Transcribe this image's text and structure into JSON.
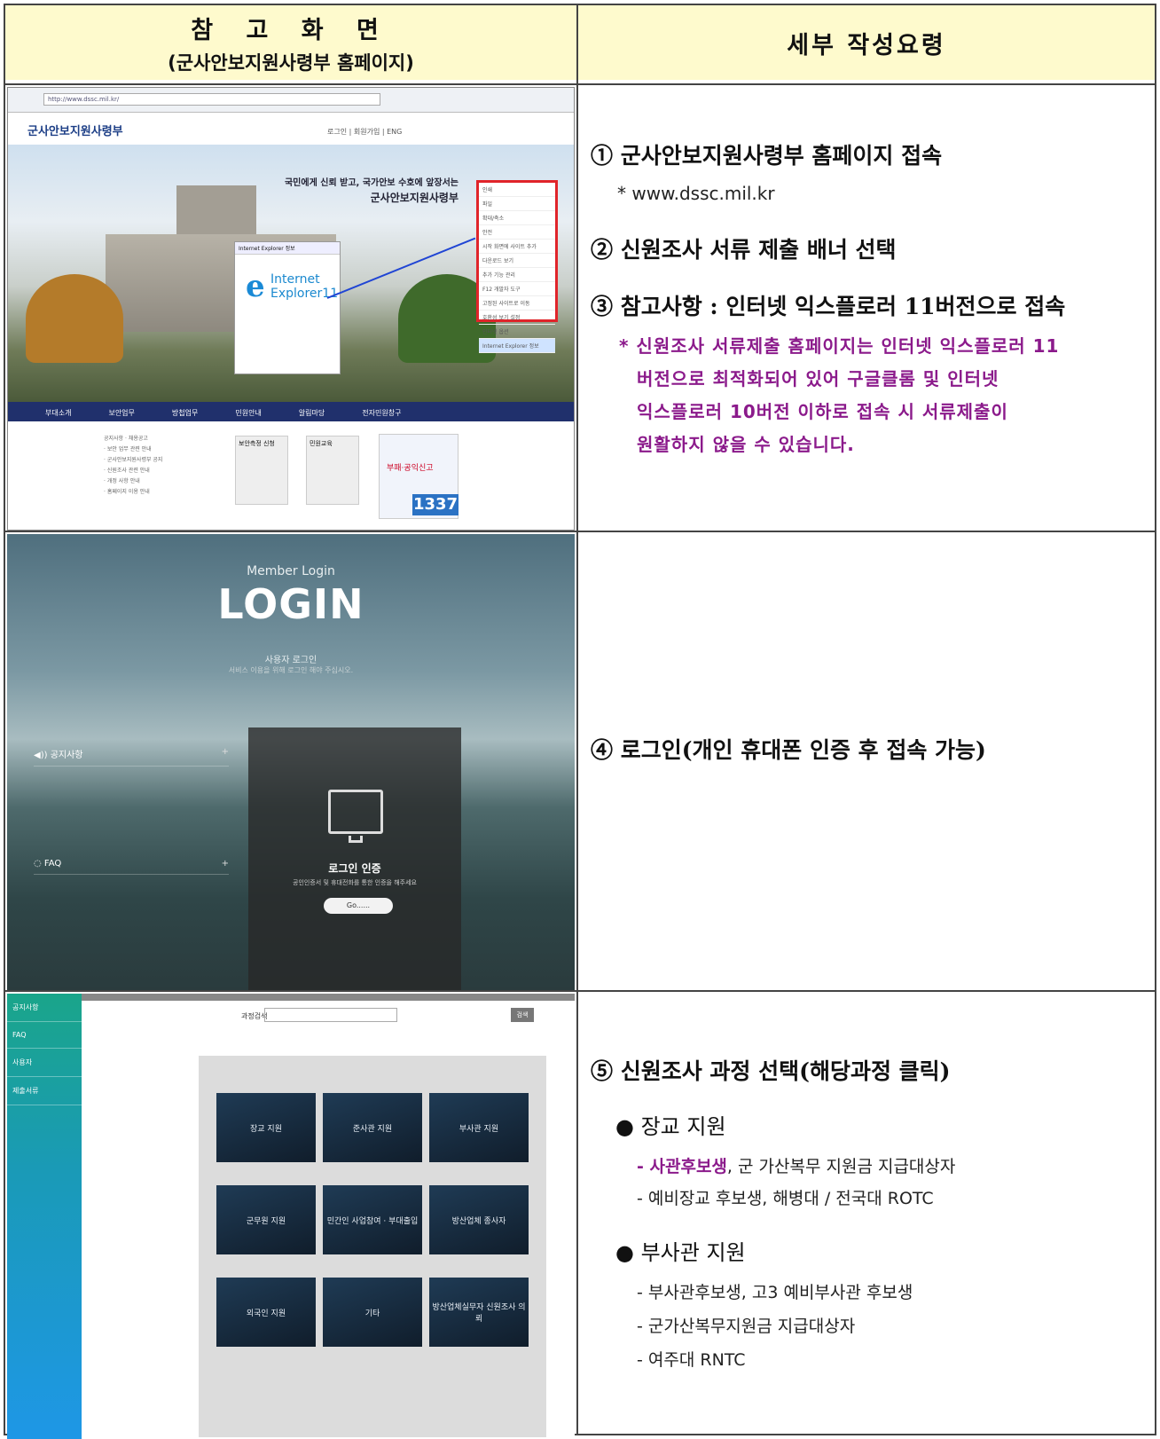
{
  "header": {
    "left_title": "참 고 화 면",
    "left_subtitle": "(군사안보지원사령부 홈페이지)",
    "right_title": "세부 작성요령"
  },
  "row1": {
    "step1": "① 군사안보지원사령부 홈페이지 접속",
    "step1_note": "* www.dssc.mil.kr",
    "step2": "② 신원조사 서류 제출 배너 선택",
    "step3": "③ 참고사항 : 인터넷 익스플로러 11버전으로 접속",
    "warning_lines": [
      "* 신원조사 서류제출 홈페이지는 인터넷 익스플로러 11",
      "버전으로 최적화되어 있어 구글클롬 및 인터넷",
      "익스플로러 10버전 이하로 접속 시 서류제출이",
      "원활하지 않을 수 있습니다."
    ],
    "screenshot": {
      "ie_name_line1": "Internet",
      "ie_name_line2": "Explorer11",
      "hero_line1": "국민에게 신뢰 받고, 국가안보 수호에 앞장서는",
      "hero_line2": "군사안보지원사령부",
      "logo_text": "군사안보지원사령부",
      "hotline": "1337",
      "banner_text": "부패·공익신고"
    }
  },
  "row2": {
    "step4": "④ 로그인(개인 휴대폰 인증 후 접속 가능)",
    "screenshot": {
      "member_login": "Member Login",
      "login": "LOGIN",
      "user_login": "사용자 로그인",
      "user_login_desc": "서비스 이용을 위해 로그인 해야 주십시오.",
      "notice": "공지사항",
      "faq": "FAQ",
      "card_title": "로그인 인증",
      "card_desc": "공인인증서 및 휴대전화를 통한 인증을 해주세요",
      "go": "Go......"
    }
  },
  "row3": {
    "step5": "⑤ 신원조사 과정 선택(해당과정 클릭)",
    "group1": {
      "title": "● 장교 지원",
      "line1_prefix": "- ",
      "line1_highlight": "사관후보생",
      "line1_rest": ", 군 가산복무 지원금 지급대상자",
      "line2": "- 예비장교 후보생, 해병대 / 전국대 ROTC"
    },
    "group2": {
      "title": "● 부사관 지원",
      "lines": [
        "- 부사관후보생, 고3 예비부사관 후보생",
        "- 군가산복무지원금 지급대상자",
        "- 여주대 RNTC"
      ]
    },
    "screenshot": {
      "sidebar": [
        "공지사항",
        "FAQ",
        "사용자",
        "제출서류"
      ],
      "search_label": "과정검색",
      "search_button": "검색",
      "courses": [
        "장교 지원",
        "준사관 지원",
        "부사관 지원",
        "군무원 지원",
        "민간인 사업참여 · 부대출입",
        "방산업체 종사자",
        "외국인 지원",
        "기타",
        "방산업체실무자 신원조사 의뢰"
      ]
    }
  }
}
